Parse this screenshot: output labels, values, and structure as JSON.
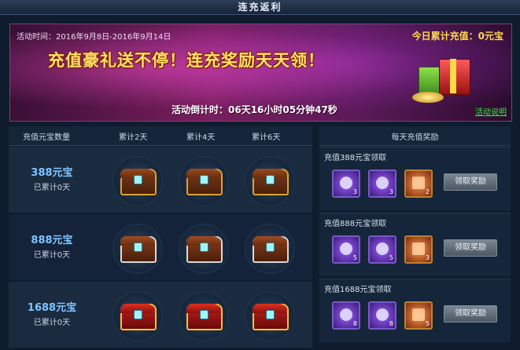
{
  "window": {
    "title": "连充返利"
  },
  "banner": {
    "activity_time": "活动时间：2016年9月8日-2016年9月14日",
    "today_total": "今日累计充值：0元宝",
    "slogan": "充值豪礼送不停！连充奖励天天领！",
    "countdown": "活动倒计时：06天16小时05分钟47秒",
    "explain_link": "活动说明"
  },
  "left_table": {
    "headers": [
      "充值元宝数量",
      "累计2天",
      "累计4天",
      "累计6天"
    ],
    "rows": [
      {
        "amount": "388元宝",
        "accumulated": "已累计0天",
        "chest_style": "gold"
      },
      {
        "amount": "888元宝",
        "accumulated": "已累计0天",
        "chest_style": "silver"
      },
      {
        "amount": "1688元宝",
        "accumulated": "已累计0天",
        "chest_style": "red"
      }
    ]
  },
  "right_panel": {
    "header": "每天充值奖励",
    "blocks": [
      {
        "label": "充值388元宝领取",
        "items": [
          {
            "icon": "purple-orb-icon",
            "count": "3"
          },
          {
            "icon": "purple-sword-icon",
            "count": "3"
          },
          {
            "icon": "orange-ore-icon",
            "count": "2"
          }
        ],
        "button": "领取奖励"
      },
      {
        "label": "充值888元宝领取",
        "items": [
          {
            "icon": "purple-orb-icon",
            "count": "5"
          },
          {
            "icon": "purple-sword-icon",
            "count": "5"
          },
          {
            "icon": "orange-ore-icon",
            "count": "3"
          }
        ],
        "button": "领取奖励"
      },
      {
        "label": "充值1688元宝领取",
        "items": [
          {
            "icon": "purple-orb-icon",
            "count": "8"
          },
          {
            "icon": "purple-sword-icon",
            "count": "8"
          },
          {
            "icon": "orange-ore-icon",
            "count": "5"
          }
        ],
        "button": "领取奖励"
      }
    ]
  }
}
